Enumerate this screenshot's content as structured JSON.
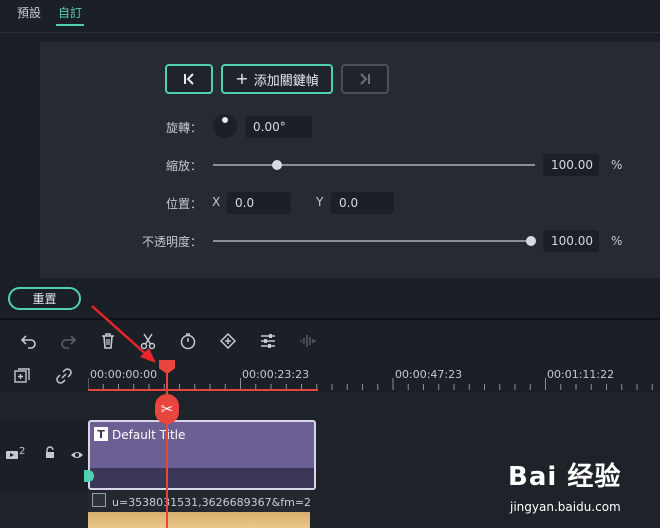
{
  "tabs": [
    {
      "label": "預設",
      "active": false
    },
    {
      "label": "自訂",
      "active": true
    }
  ],
  "keyframes": {
    "prev_icon": "prev-keyframe-icon",
    "add_label": "添加關鍵幀",
    "next_icon": "next-keyframe-icon"
  },
  "rotation": {
    "label": "旋轉：",
    "value": "0.00°"
  },
  "scale": {
    "label": "縮放：",
    "value": "100.00",
    "unit": "%",
    "level_percent": 20
  },
  "position": {
    "label": "位置：",
    "x_label": "X",
    "x_value": "0.0",
    "y_label": "Y",
    "y_value": "0.0"
  },
  "opacity": {
    "label": "不透明度：",
    "value": "100.00",
    "unit": "%",
    "level_percent": 100
  },
  "reset_label": "重置",
  "toolbar_icons": [
    "undo-icon",
    "redo-icon",
    "delete-icon",
    "cut-icon",
    "speed-icon",
    "keyframe-icon",
    "adjust-icon",
    "audio-icon"
  ],
  "ruler": {
    "timecodes": [
      "00:00:00:00",
      "00:00:23:23",
      "00:00:47:23",
      "00:01:11:22"
    ]
  },
  "track": {
    "index": "2",
    "title_clip": "Default Title",
    "media_clip": "u=3538031531,3626689367&fm=2"
  },
  "watermark": {
    "main": "Bai 经验",
    "sub": "jingyan.baidu.com"
  },
  "colors": {
    "accent": "#4fd1b1",
    "playhead": "#e8453c",
    "title_clip": "#6b5f94"
  }
}
